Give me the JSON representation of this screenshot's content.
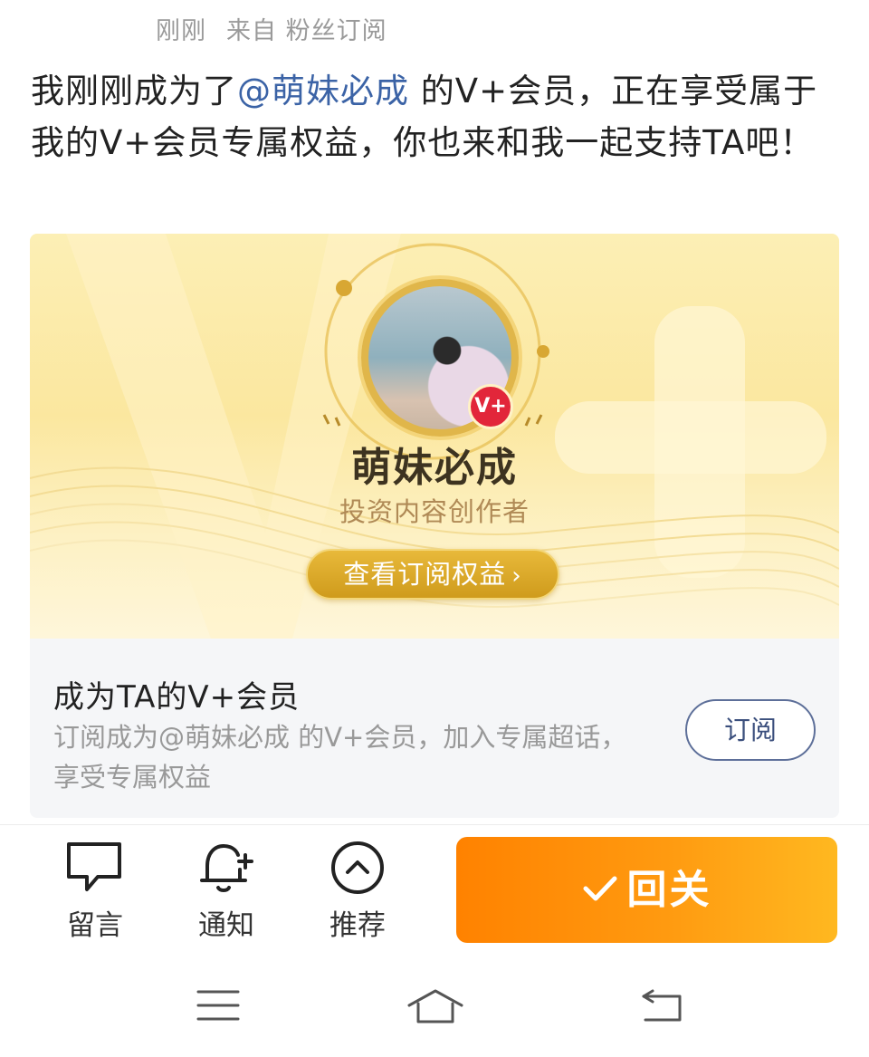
{
  "post": {
    "time": "刚刚",
    "source": "来自 粉丝订阅",
    "text_before": "我刚刚成为了",
    "mention": "@萌妹必成",
    "text_after": " 的V+会员，正在享受属于我的V+会员专属权益，你也来和我一起支持TA吧！"
  },
  "card": {
    "creator_name": "萌妹必成",
    "creator_role": "投资内容创作者",
    "badge": "V+",
    "view_button": "查看订阅权益",
    "view_chevron": "›",
    "subscribe_title": "成为TA的V+会员",
    "subscribe_desc": "订阅成为@萌妹必成 的V+会员，加入专属超话，享受专属权益",
    "subscribe_button": "订阅"
  },
  "actions": {
    "comment": "留言",
    "notify": "通知",
    "recommend": "推荐",
    "follow_back": "回关"
  },
  "icons": {
    "comment": "comment-icon",
    "notify": "bell-plus-icon",
    "recommend": "chevron-up-circle-icon",
    "follow": "check-icon",
    "nav_menu": "menu-icon",
    "nav_home": "home-icon",
    "nav_back": "back-icon"
  },
  "colors": {
    "follow_button": "#ff8c00",
    "mention": "#3b63a6",
    "banner_gold": "#e0b64a"
  }
}
